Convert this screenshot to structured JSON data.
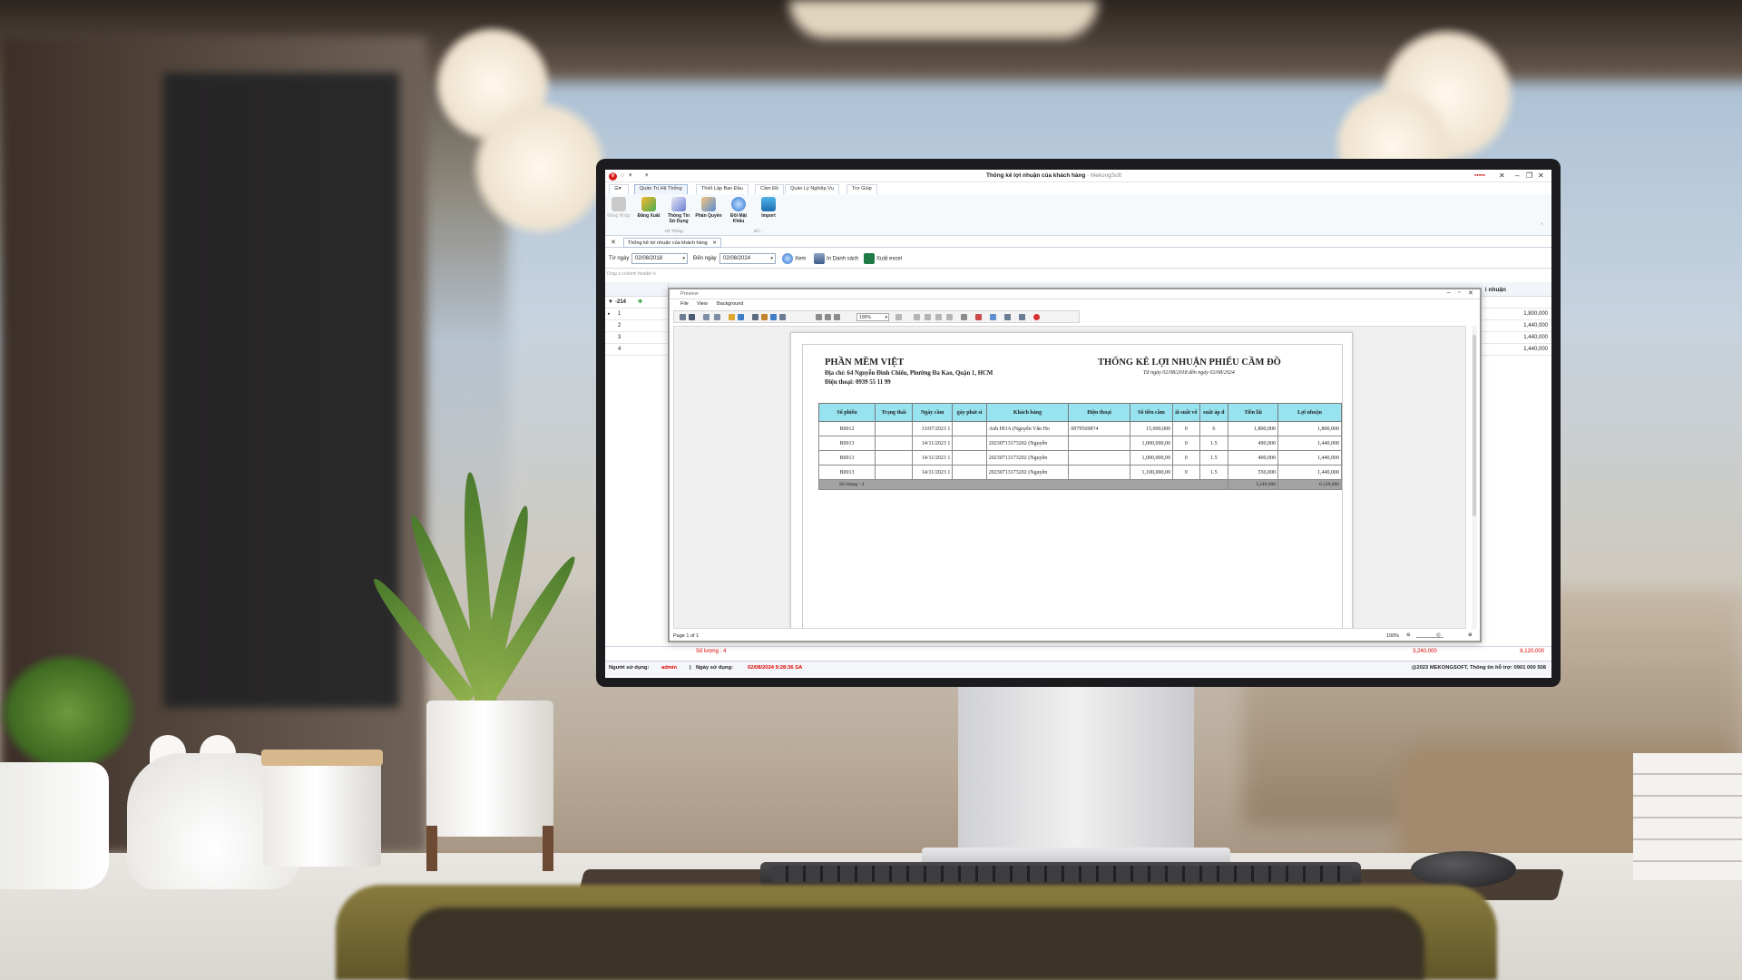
{
  "window": {
    "title": "Thống kê lợi nhuận của khách hàng",
    "vendor": "MekongSoft",
    "controls": [
      "close-icon",
      "minimize-icon",
      "maximize-icon"
    ]
  },
  "ribbon": {
    "tabs": [
      {
        "label": "Quản Trị Hệ Thống",
        "active": true
      },
      {
        "label": "Thiết Lập Ban Đầu"
      },
      {
        "label": "Cầm Đồ"
      },
      {
        "label": "Quản Lý Nghiệp Vụ"
      },
      {
        "label": "Trợ Giúp"
      }
    ],
    "buttons": [
      {
        "label": "Đăng Nhập",
        "icon": "lock-icon",
        "disabled": true
      },
      {
        "label": "Đăng Xuất",
        "icon": "logout-icon"
      },
      {
        "label": "Thông Tin Sử Dụng",
        "icon": "info-user-icon"
      },
      {
        "label": "Phân Quyền",
        "icon": "users-icon"
      },
      {
        "label": "Đổi Mật Khẩu",
        "icon": "key-icon"
      },
      {
        "label": "Import",
        "icon": "database-icon"
      }
    ],
    "groups": {
      "system": "Hệ Thống",
      "other": "Đổ..."
    }
  },
  "doc_tab": {
    "label": "Thống kê lợi nhuận của khách hàng"
  },
  "filter": {
    "from_label": "Từ ngày",
    "from_value": "02/08/2018",
    "to_label": "Đến ngày",
    "to_value": "02/08/2024",
    "view_label": "Xem",
    "print_label": "In Danh sách",
    "excel_label": "Xuất excel"
  },
  "grid": {
    "group_hint": "Drag a column header h",
    "last_column": "i nhuận",
    "filter_value": "-214",
    "rows": [
      {
        "num": "1",
        "value": "1,800,000"
      },
      {
        "num": "2",
        "value": "1,440,000"
      },
      {
        "num": "3",
        "value": "1,440,000"
      },
      {
        "num": "4",
        "value": "1,440,000"
      }
    ],
    "footer": {
      "count": "Số lượng : 4",
      "interest": "3,240,000",
      "profit": "6,120,000"
    }
  },
  "status_bar": {
    "user_label": "Người sử dụng:",
    "user_value": "admin",
    "date_label": "Ngày sử dụng:",
    "date_value": "02/08/2024 9:28:36 SA",
    "copyright": "@2023 MEKONGSOFT. Thông tin hỗ trợ: 0901 000 508"
  },
  "preview": {
    "title": "Preview",
    "menu": [
      "File",
      "View",
      "Background"
    ],
    "zoom": "100%",
    "page_info": "Page 1 of 1",
    "bottom_zoom": "100%",
    "report": {
      "company": "PHẦN MỀM VIỆT",
      "address": "Địa chỉ: 64 Nguyễn Đình Chiểu, Phường Đa Kao, Quận 1, HCM",
      "phone": "Điện thoại: 0939 55 11 99",
      "title": "THỐNG KÊ LỢI NHUẬN PHIẾU CẦM ĐỒ",
      "range": "Từ ngày 02/08/2018 đến ngày 02/08/2024",
      "columns": [
        "Số phiếu",
        "Trạng thái",
        "Ngày cầm",
        "gày phát si",
        "Khách hàng",
        "Điện thoại",
        "Số tiền cầm",
        "ãi suất vố",
        "suất áp d",
        "Tiền lãi",
        "Lợi nhuận"
      ],
      "rows": [
        [
          "B0012",
          "",
          "13/07/2023 1",
          "",
          "Anh HOA (Nguyễn Văn Ho",
          "0979569874",
          "15,000,000",
          "0",
          "6",
          "1,800,000",
          "1,800,000"
        ],
        [
          "B0013",
          "",
          "14/11/2023 1",
          "",
          "20230713173202 (Nguyễn",
          "",
          "1,000,000,00",
          "0",
          "1.5",
          "490,000",
          "1,440,000"
        ],
        [
          "B0013",
          "",
          "14/11/2023 1",
          "",
          "20230713173202 (Nguyễn",
          "",
          "1,000,000,00",
          "0",
          "1.5",
          "400,000",
          "1,440,000"
        ],
        [
          "B0013",
          "",
          "14/11/2023 1",
          "",
          "20230713173202 (Nguyễn",
          "",
          "1,100,000,00",
          "0",
          "1.5",
          "550,000",
          "1,440,000"
        ]
      ],
      "total": {
        "count": "Số lượng : 4",
        "interest": "3,240,000",
        "profit": "6,120,000"
      }
    }
  },
  "colors": {
    "header_cyan": "#97e3f0",
    "accent_red": "#d81e1e",
    "total_gray": "#a3a3a3"
  }
}
